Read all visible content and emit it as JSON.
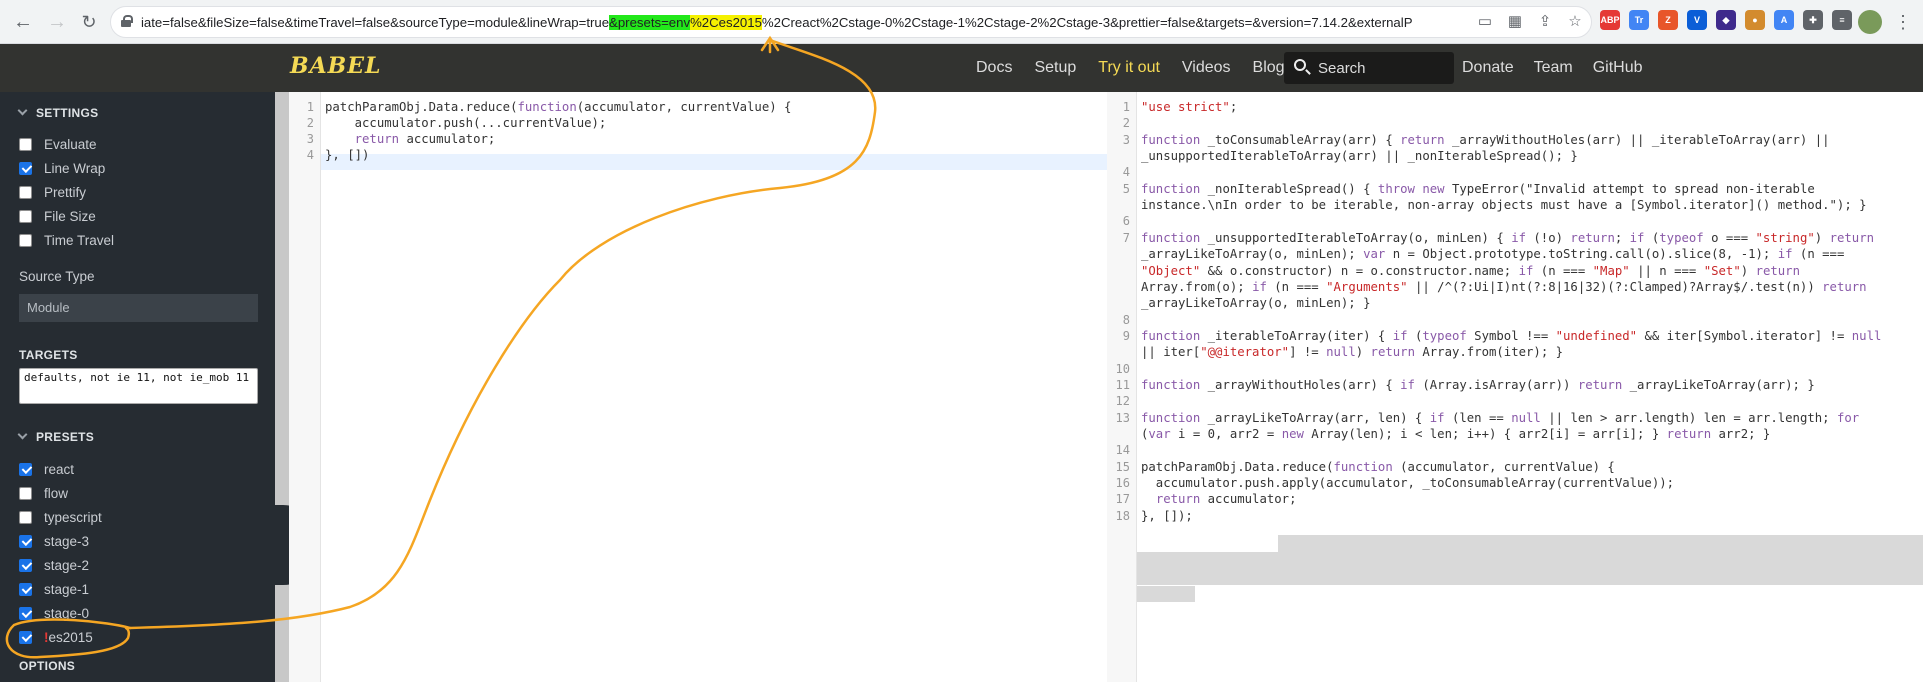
{
  "browser": {
    "url_parts": {
      "pre": "iate=false&fileSize=false&timeTravel=false&sourceType=module&lineWrap=true",
      "green": "&presets=env",
      "yellow": "%2Ces2015",
      "post": "%2Creact%2Cstage-0%2Cstage-1%2Cstage-2%2Cstage-3&prettier=false&targets=&version=7.14.2&externalP"
    },
    "extensions": [
      {
        "name": "ABP",
        "color": "#e53935"
      },
      {
        "name": "Tr",
        "color": "#4285f4"
      },
      {
        "name": "Z",
        "color": "#e8562a"
      },
      {
        "name": "V",
        "color": "#0b5ed7"
      },
      {
        "name": "◆",
        "color": "#3f2a8c"
      },
      {
        "name": "●",
        "color": "#d38b2e"
      },
      {
        "name": "A",
        "color": "#4285f4"
      },
      {
        "name": "✚",
        "color": "#5f6368"
      },
      {
        "name": "≡",
        "color": "#5f6368"
      }
    ]
  },
  "header": {
    "logo": "BABEL",
    "nav": [
      "Docs",
      "Setup",
      "Try it out",
      "Videos",
      "Blog"
    ],
    "search_placeholder": "Search",
    "nav2": [
      "Donate",
      "Team",
      "GitHub"
    ]
  },
  "sidebar": {
    "settings_title": "SETTINGS",
    "settings": [
      {
        "label": "Evaluate",
        "checked": false
      },
      {
        "label": "Line Wrap",
        "checked": true
      },
      {
        "label": "Prettify",
        "checked": false
      },
      {
        "label": "File Size",
        "checked": false
      },
      {
        "label": "Time Travel",
        "checked": false
      }
    ],
    "source_type_label": "Source Type",
    "source_type_value": "Module",
    "targets_title": "TARGETS",
    "targets_value": "defaults, not ie 11, not ie_mob 11",
    "presets_title": "PRESETS",
    "presets": [
      {
        "label": "react",
        "checked": true
      },
      {
        "label": "flow",
        "checked": false
      },
      {
        "label": "typescript",
        "checked": false
      },
      {
        "label": "stage-3",
        "checked": true
      },
      {
        "label": "stage-2",
        "checked": true
      },
      {
        "label": "stage-1",
        "checked": true
      },
      {
        "label": "stage-0",
        "checked": true
      },
      {
        "label": "es2015",
        "checked": true,
        "warn": "!"
      }
    ],
    "options_title": "OPTIONS"
  },
  "input_editor": {
    "line_numbers": [
      "1",
      "2",
      "3",
      "4"
    ],
    "lines": [
      "patchParamObj.Data.reduce(function(accumulator, currentValue) {",
      "    accumulator.push(...currentValue);",
      "    return accumulator;",
      "}, [])"
    ]
  },
  "output_editor": {
    "line_numbers": [
      "1",
      "2",
      "3",
      "4",
      "5",
      "6",
      "7",
      "8",
      "9",
      "10",
      "11",
      "12",
      "13",
      "14",
      "15",
      "16",
      "17",
      "18"
    ],
    "lines": [
      "\"use strict\";",
      "",
      "function _toConsumableArray(arr) { return _arrayWithoutHoles(arr) || _iterableToArray(arr) ||",
      "_unsupportedIterableToArray(arr) || _nonIterableSpread(); }",
      "",
      "function _nonIterableSpread() { throw new TypeError(\"Invalid attempt to spread non-iterable",
      "instance.\\nIn order to be iterable, non-array objects must have a [Symbol.iterator]() method.\"); }",
      "",
      "function _unsupportedIterableToArray(o, minLen) { if (!o) return; if (typeof o === \"string\") return",
      "_arrayLikeToArray(o, minLen); var n = Object.prototype.toString.call(o).slice(8, -1); if (n ===",
      "\"Object\" && o.constructor) n = o.constructor.name; if (n === \"Map\" || n === \"Set\") return",
      "Array.from(o); if (n === \"Arguments\" || /^(?:Ui|I)nt(?:8|16|32)(?:Clamped)?Array$/.test(n)) return",
      "_arrayLikeToArray(o, minLen); }",
      "",
      "function _iterableToArray(iter) { if (typeof Symbol !== \"undefined\" && iter[Symbol.iterator] != null",
      "|| iter[\"@@iterator\"] != null) return Array.from(iter); }",
      "",
      "function _arrayWithoutHoles(arr) { if (Array.isArray(arr)) return _arrayLikeToArray(arr); }",
      "",
      "function _arrayLikeToArray(arr, len) { if (len == null || len > arr.length) len = arr.length; for",
      "(var i = 0, arr2 = new Array(len); i < len; i++) { arr2[i] = arr[i]; } return arr2; }",
      "",
      "patchParamObj.Data.reduce(function (accumulator, currentValue) {",
      "  accumulator.push.apply(accumulator, _toConsumableArray(currentValue));",
      "  return accumulator;",
      "}, []);"
    ]
  }
}
